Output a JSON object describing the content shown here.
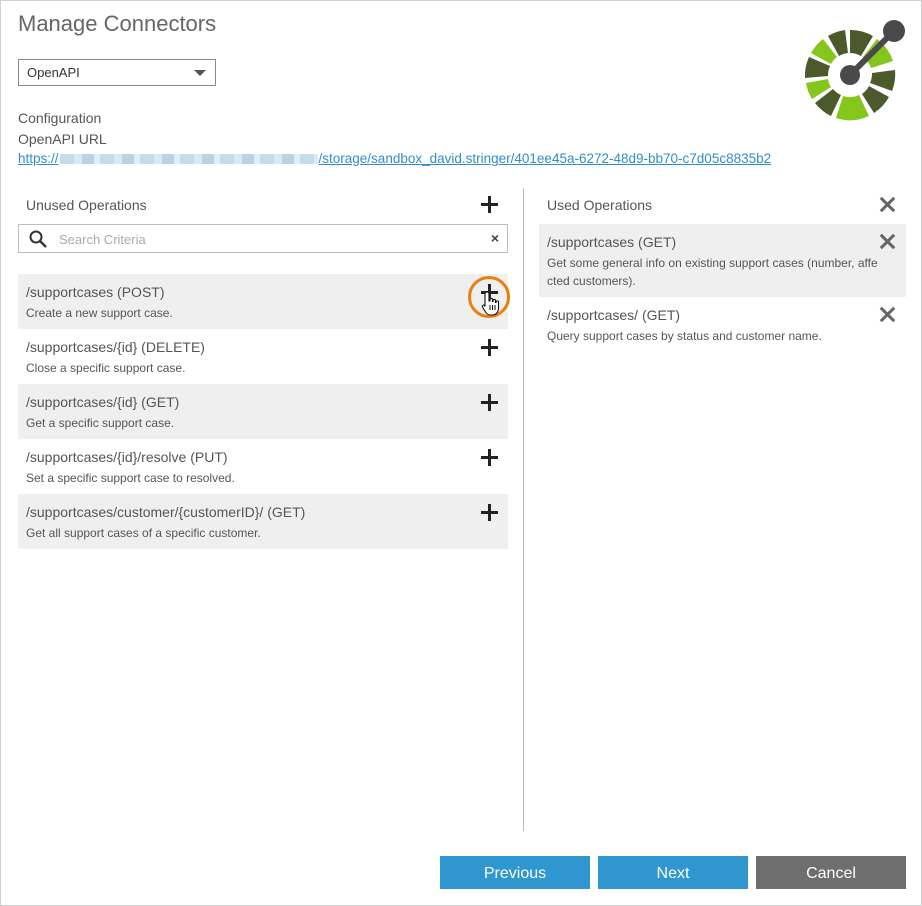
{
  "dialog": {
    "title": "Manage Connectors"
  },
  "connector_type": {
    "selected": "OpenAPI"
  },
  "configuration": {
    "section_label": "Configuration",
    "url_label": "OpenAPI URL",
    "url_prefix": "https://",
    "url_suffix": "/storage/sandbox_david.stringer/401ee45a-6272-48d9-bb70-c7d05c8835b2"
  },
  "unused": {
    "heading": "Unused Operations",
    "search_placeholder": "Search Criteria",
    "clear_label": "×",
    "operations": [
      {
        "name": "/supportcases (POST)",
        "desc": "Create a new support case."
      },
      {
        "name": "/supportcases/{id} (DELETE)",
        "desc": "Close a specific support case."
      },
      {
        "name": "/supportcases/{id} (GET)",
        "desc": "Get a specific support case."
      },
      {
        "name": "/supportcases/{id}/resolve (PUT)",
        "desc": "Set a specific support case to resolved."
      },
      {
        "name": "/supportcases/customer/{customerID}/ (GET)",
        "desc": "Get all support cases of a specific customer."
      }
    ]
  },
  "used": {
    "heading": "Used Operations",
    "operations": [
      {
        "name": "/supportcases (GET)",
        "desc_line1": "Get some general info on existing support cases (number, affe",
        "desc_line2": "cted customers)."
      },
      {
        "name": "/supportcases/ (GET)",
        "desc_line1": "Query support cases by status and customer name."
      }
    ]
  },
  "footer": {
    "previous": "Previous",
    "next": "Next",
    "cancel": "Cancel"
  },
  "colors": {
    "primary_button": "#2f96cf",
    "cancel_button": "#6e6e6e",
    "link": "#2f8ec9",
    "highlight_ring": "#e8800f",
    "logo_dark": "#4b5a2d",
    "logo_light": "#85c61c"
  }
}
